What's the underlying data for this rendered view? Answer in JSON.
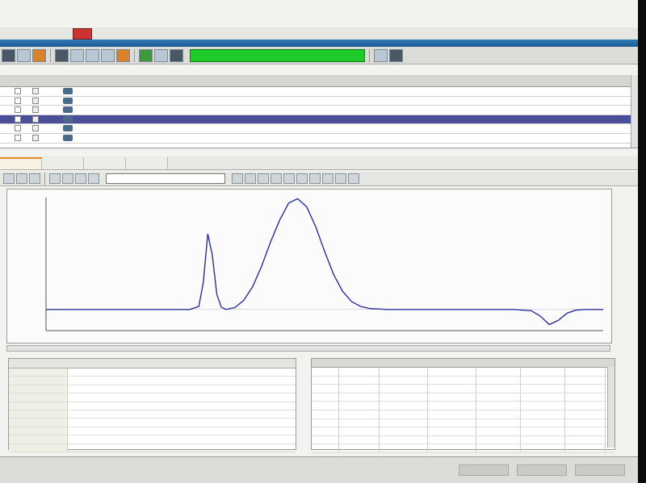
{
  "chart_data": {
    "type": "line",
    "x": [
      0,
      2,
      4,
      6,
      8,
      10,
      12,
      14,
      16,
      17,
      17.5,
      18,
      18.5,
      19,
      19.5,
      20,
      21,
      22,
      23,
      24,
      25,
      26,
      27,
      28,
      29,
      30,
      31,
      32,
      33,
      34,
      35,
      36,
      38,
      40,
      42,
      44,
      46,
      48,
      50,
      52,
      54,
      55,
      56,
      57,
      58,
      59,
      60,
      62
    ],
    "y": [
      0,
      0,
      0,
      0,
      0,
      0,
      0,
      0,
      0,
      50,
      450,
      1250,
      900,
      250,
      40,
      0,
      30,
      150,
      380,
      720,
      1120,
      1480,
      1760,
      1830,
      1700,
      1370,
      960,
      580,
      300,
      130,
      50,
      15,
      0,
      0,
      0,
      0,
      0,
      0,
      0,
      0,
      -20,
      -110,
      -250,
      -180,
      -60,
      -10,
      0,
      0
    ],
    "ylim": [
      -350,
      1850
    ],
    "xlim": [
      0,
      62
    ],
    "grid": false
  }
}
